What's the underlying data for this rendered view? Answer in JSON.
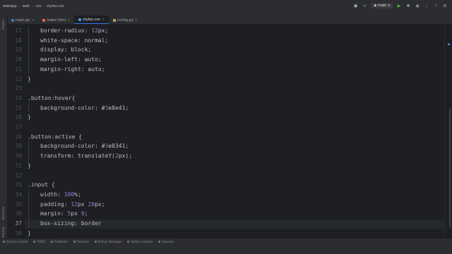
{
  "colors": {
    "accent": "#3574f0",
    "background": "#1e1f22",
    "panel": "#2b2d30",
    "number": "#8e7cd6",
    "run": "#5fb832"
  },
  "titlebar": {
    "breadcrumbs": [
      "webapp",
      "web",
      "css",
      "styles.css"
    ],
    "run_config": "main"
  },
  "tabs": [
    {
      "label": "main.py",
      "icon": "python-file-icon",
      "color": "#3f78c4",
      "active": false
    },
    {
      "label": "index.html",
      "icon": "html-file-icon",
      "color": "#e06b3c",
      "active": false
    },
    {
      "label": "styles.css",
      "icon": "css-file-icon",
      "color": "#3aa0d8",
      "active": true
    },
    {
      "label": "config.py",
      "icon": "python-file-icon",
      "color": "#c0a63f",
      "active": false
    }
  ],
  "left_tools": [
    "Project",
    "Structure",
    "Bookmarks"
  ],
  "editor": {
    "current_line": "37",
    "lines": [
      {
        "n": "17",
        "indent": 1,
        "parts": [
          [
            "prop",
            "border-radius: "
          ],
          [
            "num",
            "12"
          ],
          [
            "val",
            "px;"
          ]
        ]
      },
      {
        "n": "18",
        "indent": 1,
        "parts": [
          [
            "prop",
            "white-space: normal;"
          ]
        ]
      },
      {
        "n": "19",
        "indent": 1,
        "parts": [
          [
            "prop",
            "display: block;"
          ]
        ]
      },
      {
        "n": "20",
        "indent": 1,
        "parts": [
          [
            "prop",
            "margin-left: auto;"
          ]
        ]
      },
      {
        "n": "21",
        "indent": 1,
        "parts": [
          [
            "prop",
            "margin-right: auto;"
          ]
        ]
      },
      {
        "n": "22",
        "indent": 0,
        "parts": [
          [
            "sel",
            "}"
          ]
        ]
      },
      {
        "n": "23",
        "indent": 0,
        "parts": []
      },
      {
        "n": "24",
        "indent": 0,
        "parts": [
          [
            "sel",
            ".button:hover{"
          ]
        ]
      },
      {
        "n": "25",
        "indent": 1,
        "parts": [
          [
            "prop",
            "background-color: #"
          ],
          [
            "num",
            "3"
          ],
          [
            "val",
            "e8e41;"
          ]
        ]
      },
      {
        "n": "26",
        "indent": 0,
        "parts": [
          [
            "sel",
            "}"
          ]
        ]
      },
      {
        "n": "27",
        "indent": 0,
        "parts": []
      },
      {
        "n": "28",
        "indent": 0,
        "parts": [
          [
            "sel",
            ".button:active {"
          ]
        ]
      },
      {
        "n": "29",
        "indent": 1,
        "parts": [
          [
            "prop",
            "background-color: #"
          ],
          [
            "num",
            "3"
          ],
          [
            "val",
            "e8341;"
          ]
        ]
      },
      {
        "n": "30",
        "indent": 1,
        "parts": [
          [
            "prop",
            "transform: translateY("
          ],
          [
            "num",
            "2"
          ],
          [
            "val",
            "px);"
          ]
        ]
      },
      {
        "n": "31",
        "indent": 0,
        "parts": [
          [
            "sel",
            "}"
          ]
        ]
      },
      {
        "n": "32",
        "indent": 0,
        "parts": []
      },
      {
        "n": "33",
        "indent": 0,
        "parts": [
          [
            "sel",
            ".input {"
          ]
        ]
      },
      {
        "n": "34",
        "indent": 1,
        "parts": [
          [
            "prop",
            "width: "
          ],
          [
            "num",
            "100"
          ],
          [
            "val",
            "%;"
          ]
        ]
      },
      {
        "n": "35",
        "indent": 1,
        "parts": [
          [
            "prop",
            "padding: "
          ],
          [
            "num",
            "12"
          ],
          [
            "val",
            "px "
          ],
          [
            "num",
            "20"
          ],
          [
            "val",
            "px;"
          ]
        ]
      },
      {
        "n": "36",
        "indent": 1,
        "parts": [
          [
            "prop",
            "margin: "
          ],
          [
            "num",
            "5"
          ],
          [
            "val",
            "px "
          ],
          [
            "num",
            "0"
          ],
          [
            "val",
            ";"
          ]
        ]
      },
      {
        "n": "37",
        "indent": 1,
        "parts": [
          [
            "prop",
            "box-sizing: border"
          ]
        ]
      },
      {
        "n": "38",
        "indent": 0,
        "parts": [
          [
            "sel",
            "}"
          ]
        ]
      }
    ]
  },
  "statusbar": {
    "items": [
      "Version Control",
      "TODO",
      "Problems",
      "Terminal",
      "Python Packages",
      "Python Console",
      "Services"
    ]
  }
}
